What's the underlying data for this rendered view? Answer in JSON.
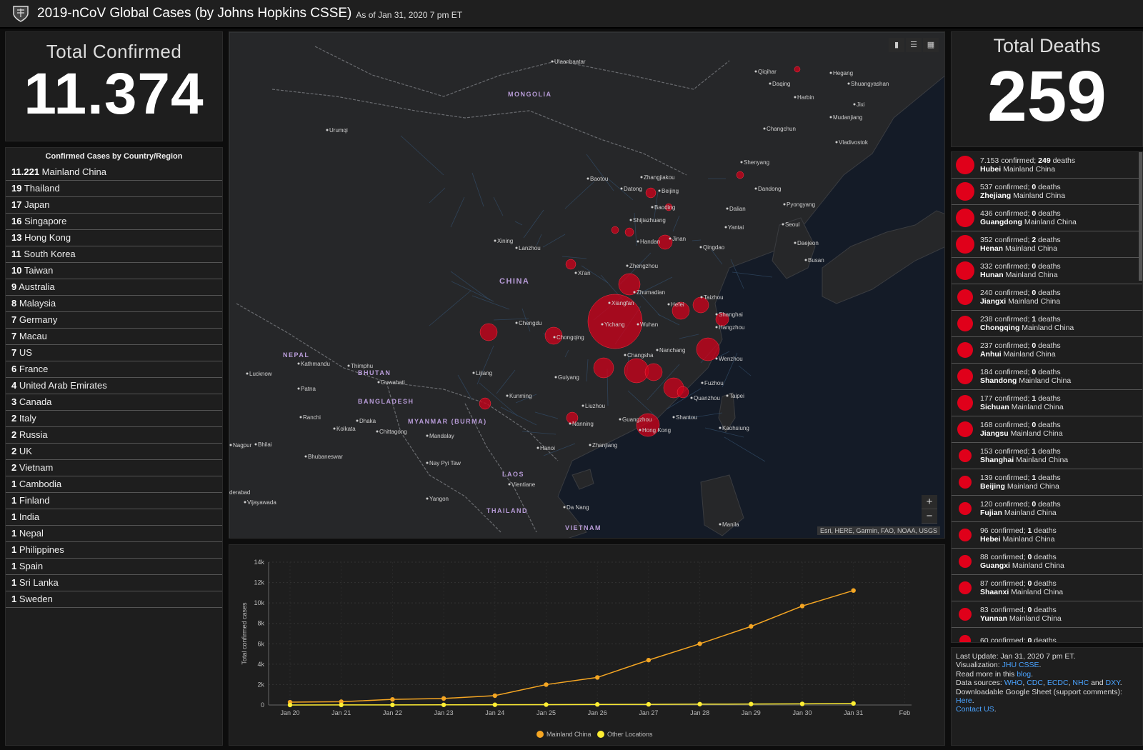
{
  "header": {
    "title": "2019-nCoV Global Cases (by Johns Hopkins CSSE)",
    "subtitle": "As of Jan 31, 2020 7 pm ET"
  },
  "total_confirmed": {
    "label": "Total Confirmed",
    "value": "11.374"
  },
  "country_list": {
    "title": "Confirmed Cases by Country/Region",
    "items": [
      {
        "count": "11.221",
        "name": "Mainland China"
      },
      {
        "count": "19",
        "name": "Thailand"
      },
      {
        "count": "17",
        "name": "Japan"
      },
      {
        "count": "16",
        "name": "Singapore"
      },
      {
        "count": "13",
        "name": "Hong Kong"
      },
      {
        "count": "11",
        "name": "South Korea"
      },
      {
        "count": "10",
        "name": "Taiwan"
      },
      {
        "count": "9",
        "name": "Australia"
      },
      {
        "count": "8",
        "name": "Malaysia"
      },
      {
        "count": "7",
        "name": "Germany"
      },
      {
        "count": "7",
        "name": "Macau"
      },
      {
        "count": "7",
        "name": "US"
      },
      {
        "count": "6",
        "name": "France"
      },
      {
        "count": "4",
        "name": "United Arab Emirates"
      },
      {
        "count": "3",
        "name": "Canada"
      },
      {
        "count": "2",
        "name": "Italy"
      },
      {
        "count": "2",
        "name": "Russia"
      },
      {
        "count": "2",
        "name": "UK"
      },
      {
        "count": "2",
        "name": "Vietnam"
      },
      {
        "count": "1",
        "name": "Cambodia"
      },
      {
        "count": "1",
        "name": "Finland"
      },
      {
        "count": "1",
        "name": "India"
      },
      {
        "count": "1",
        "name": "Nepal"
      },
      {
        "count": "1",
        "name": "Philippines"
      },
      {
        "count": "1",
        "name": "Spain"
      },
      {
        "count": "1",
        "name": "Sri Lanka"
      },
      {
        "count": "1",
        "name": "Sweden"
      }
    ]
  },
  "map": {
    "attribution": "Esri, HERE, Garmin, FAO, NOAA, USGS",
    "toolbar": [
      "bookmark-icon",
      "list-icon",
      "grid-icon"
    ],
    "zoom_in": "+",
    "zoom_out": "−",
    "region_labels": [
      "MONGOLIA",
      "CHINA",
      "NEPAL",
      "BHUTAN",
      "BANGLADESH",
      "MYANMAR (BURMA)",
      "LAOS",
      "THAILAND",
      "VIETNAM"
    ],
    "city_labels": [
      "Ulaanbaatar",
      "Qiqihar",
      "Daqing",
      "Harbin",
      "Hegang",
      "Shuangyashan",
      "Jixi",
      "Mudanjiang",
      "Changchun",
      "Vladivostok",
      "Urumqi",
      "Shenyang",
      "Dandong",
      "Pyongyang",
      "Seoul",
      "Daejeon",
      "Busan",
      "Baotou",
      "Datong",
      "Zhangjiakou",
      "Beijing",
      "Baoding",
      "Dalian",
      "Shijiazhuang",
      "Yantai",
      "Handan",
      "Jinan",
      "Qingdao",
      "Xining",
      "Lanzhou",
      "Xi'an",
      "Zhengzhou",
      "Zhumadian",
      "Taizhou",
      "Hefei",
      "Shanghai",
      "Xiangfan",
      "Yichang",
      "Wuhan",
      "Hangzhou",
      "Chengdu",
      "Chongqing",
      "Nanchang",
      "Wenzhou",
      "Changsha",
      "Kathmandu",
      "Thimphu",
      "Lucknow",
      "Lijiang",
      "Guiyang",
      "Fuzhou",
      "Patna",
      "Guwahati",
      "Kunming",
      "Quanzhou",
      "Taipei",
      "Ranchi",
      "Dhaka",
      "Liuzhou",
      "Kaohsiung",
      "Shantou",
      "Nanning",
      "Guangzhou",
      "Hong Kong",
      "Kolkata",
      "Chittagong",
      "Mandalay",
      "Nagpur",
      "Bhilai",
      "Zhanjiang",
      "Hanoi",
      "Bhubaneswar",
      "Nay Pyi Taw",
      "Vientiane",
      "Yangon",
      "Da Nang",
      "Manila",
      "Vijayawada",
      "derabad"
    ]
  },
  "chart_data": {
    "type": "line",
    "title": "",
    "xlabel": "",
    "ylabel": "Total confirmed cases",
    "categories": [
      "Jan 20",
      "Jan 21",
      "Jan 22",
      "Jan 23",
      "Jan 24",
      "Jan 25",
      "Jan 26",
      "Jan 27",
      "Jan 28",
      "Jan 29",
      "Jan 30",
      "Jan 31",
      "Feb"
    ],
    "ylim": [
      0,
      14000
    ],
    "yticks": [
      "0",
      "2k",
      "4k",
      "6k",
      "8k",
      "10k",
      "12k",
      "14k"
    ],
    "ytick_values": [
      0,
      2000,
      4000,
      6000,
      8000,
      10000,
      12000,
      14000
    ],
    "grid": true,
    "legend_position": "bottom-center",
    "series": [
      {
        "name": "Mainland China",
        "color": "#f5a623",
        "values": [
          278,
          326,
          547,
          639,
          916,
          2000,
          2700,
          4400,
          6000,
          7700,
          9700,
          11221
        ]
      },
      {
        "name": "Other Locations",
        "color": "#ffee33",
        "values": [
          4,
          7,
          10,
          15,
          25,
          38,
          55,
          65,
          85,
          95,
          110,
          153
        ]
      }
    ]
  },
  "total_deaths": {
    "label": "Total Deaths",
    "value": "259"
  },
  "province_list": {
    "items": [
      {
        "confirmed": "7.153",
        "deaths": "249",
        "name": "Hubei",
        "region": "Mainland China",
        "size": 1.0
      },
      {
        "confirmed": "537",
        "deaths": "0",
        "name": "Zhejiang",
        "region": "Mainland China",
        "size": 1.0
      },
      {
        "confirmed": "436",
        "deaths": "0",
        "name": "Guangdong",
        "region": "Mainland China",
        "size": 1.0
      },
      {
        "confirmed": "352",
        "deaths": "2",
        "name": "Henan",
        "region": "Mainland China",
        "size": 1.0
      },
      {
        "confirmed": "332",
        "deaths": "0",
        "name": "Hunan",
        "region": "Mainland China",
        "size": 1.0
      },
      {
        "confirmed": "240",
        "deaths": "0",
        "name": "Jiangxi",
        "region": "Mainland China",
        "size": 0.85
      },
      {
        "confirmed": "238",
        "deaths": "1",
        "name": "Chongqing",
        "region": "Mainland China",
        "size": 0.85
      },
      {
        "confirmed": "237",
        "deaths": "0",
        "name": "Anhui",
        "region": "Mainland China",
        "size": 0.85
      },
      {
        "confirmed": "184",
        "deaths": "0",
        "name": "Shandong",
        "region": "Mainland China",
        "size": 0.85
      },
      {
        "confirmed": "177",
        "deaths": "1",
        "name": "Sichuan",
        "region": "Mainland China",
        "size": 0.85
      },
      {
        "confirmed": "168",
        "deaths": "0",
        "name": "Jiangsu",
        "region": "Mainland China",
        "size": 0.85
      },
      {
        "confirmed": "153",
        "deaths": "1",
        "name": "Shanghai",
        "region": "Mainland China",
        "size": 0.7
      },
      {
        "confirmed": "139",
        "deaths": "1",
        "name": "Beijing",
        "region": "Mainland China",
        "size": 0.7
      },
      {
        "confirmed": "120",
        "deaths": "0",
        "name": "Fujian",
        "region": "Mainland China",
        "size": 0.7
      },
      {
        "confirmed": "96",
        "deaths": "1",
        "name": "Hebei",
        "region": "Mainland China",
        "size": 0.7
      },
      {
        "confirmed": "88",
        "deaths": "0",
        "name": "Guangxi",
        "region": "Mainland China",
        "size": 0.7
      },
      {
        "confirmed": "87",
        "deaths": "0",
        "name": "Shaanxi",
        "region": "Mainland China",
        "size": 0.7
      },
      {
        "confirmed": "83",
        "deaths": "0",
        "name": "Yunnan",
        "region": "Mainland China",
        "size": 0.7
      },
      {
        "confirmed": "60",
        "deaths": "0",
        "name": "",
        "region": "",
        "size": 0.6
      }
    ]
  },
  "info": {
    "last_update": "Last Update: Jan 31, 2020 7 pm ET.",
    "visualization_prefix": "Visualization: ",
    "visualization_link": "JHU CSSE",
    "read_more_prefix": "Read more in this ",
    "read_more_link": "blog",
    "sources_prefix": "Data sources: ",
    "sources": [
      "WHO",
      "CDC",
      "ECDC",
      "NHC",
      "DXY"
    ],
    "sources_and": "and",
    "sheet_text": "Downloadable Google Sheet (support comments): ",
    "sheet_link": "Here",
    "contact_link": "Contact US"
  },
  "colors": {
    "bubble": "#d0021b",
    "accent_link": "#4aa3ff",
    "china_line": "#f5a623",
    "other_line": "#ffee33"
  }
}
